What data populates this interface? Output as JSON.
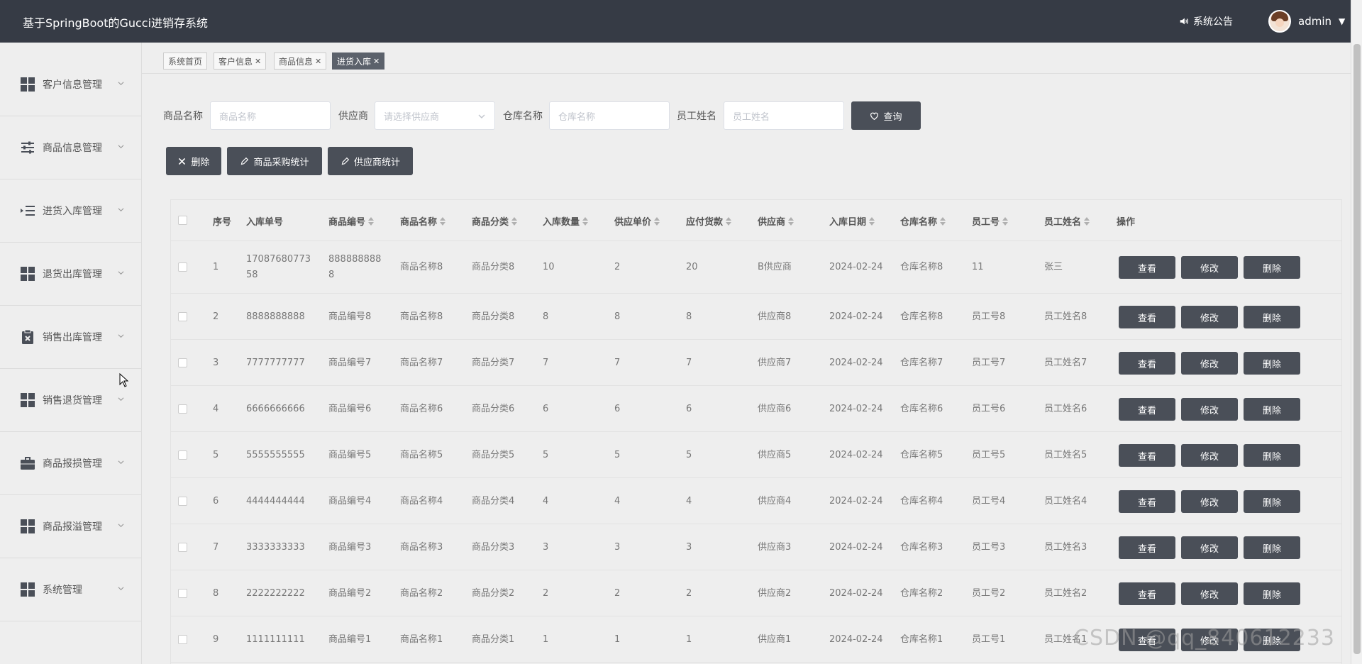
{
  "header": {
    "title": "基于SpringBoot的Gucci进销存系统",
    "notice_label": "系统公告",
    "username": "admin"
  },
  "sidebar": {
    "items": [
      {
        "label": "客户信息管理",
        "icon": "grid-icon"
      },
      {
        "label": "商品信息管理",
        "icon": "sliders-icon"
      },
      {
        "label": "进货入库管理",
        "icon": "indent-list-icon"
      },
      {
        "label": "退货出库管理",
        "icon": "grid-icon"
      },
      {
        "label": "销售出库管理",
        "icon": "clipboard-x-icon"
      },
      {
        "label": "销售退货管理",
        "icon": "grid-icon"
      },
      {
        "label": "商品报损管理",
        "icon": "briefcase-icon"
      },
      {
        "label": "商品报溢管理",
        "icon": "grid-icon"
      },
      {
        "label": "系统管理",
        "icon": "grid-icon"
      }
    ]
  },
  "tabs": [
    {
      "label": "系统首页",
      "closable": false,
      "active": false
    },
    {
      "label": "客户信息",
      "closable": true,
      "active": false
    },
    {
      "label": "商品信息",
      "closable": true,
      "active": false
    },
    {
      "label": "进货入库",
      "closable": true,
      "active": true
    }
  ],
  "search": {
    "product_name_label": "商品名称",
    "product_name_placeholder": "商品名称",
    "supplier_label": "供应商",
    "supplier_placeholder": "请选择供应商",
    "warehouse_label": "仓库名称",
    "warehouse_placeholder": "仓库名称",
    "employee_label": "员工姓名",
    "employee_placeholder": "员工姓名",
    "query_label": "查询"
  },
  "toolbar": {
    "delete_label": "删除",
    "purchase_stats_label": "商品采购统计",
    "supplier_stats_label": "供应商统计"
  },
  "table": {
    "columns": [
      "序号",
      "入库单号",
      "商品编号",
      "商品名称",
      "商品分类",
      "入库数量",
      "供应单价",
      "应付货款",
      "供应商",
      "入库日期",
      "仓库名称",
      "员工号",
      "员工姓名",
      "操作"
    ],
    "rows": [
      {
        "index": "1",
        "order_no": "17087680773 58",
        "product_code": "888888888 8",
        "product_name": "商品名称8",
        "category": "商品分类8",
        "qty": "10",
        "price": "2",
        "payable": "20",
        "supplier": "B供应商",
        "date": "2024-02-24",
        "warehouse": "仓库名称8",
        "emp_no": "11",
        "emp_name": "张三"
      },
      {
        "index": "2",
        "order_no": "8888888888",
        "product_code": "商品编号8",
        "product_name": "商品名称8",
        "category": "商品分类8",
        "qty": "8",
        "price": "8",
        "payable": "8",
        "supplier": "供应商8",
        "date": "2024-02-24",
        "warehouse": "仓库名称8",
        "emp_no": "员工号8",
        "emp_name": "员工姓名8"
      },
      {
        "index": "3",
        "order_no": "7777777777",
        "product_code": "商品编号7",
        "product_name": "商品名称7",
        "category": "商品分类7",
        "qty": "7",
        "price": "7",
        "payable": "7",
        "supplier": "供应商7",
        "date": "2024-02-24",
        "warehouse": "仓库名称7",
        "emp_no": "员工号7",
        "emp_name": "员工姓名7"
      },
      {
        "index": "4",
        "order_no": "6666666666",
        "product_code": "商品编号6",
        "product_name": "商品名称6",
        "category": "商品分类6",
        "qty": "6",
        "price": "6",
        "payable": "6",
        "supplier": "供应商6",
        "date": "2024-02-24",
        "warehouse": "仓库名称6",
        "emp_no": "员工号6",
        "emp_name": "员工姓名6"
      },
      {
        "index": "5",
        "order_no": "5555555555",
        "product_code": "商品编号5",
        "product_name": "商品名称5",
        "category": "商品分类5",
        "qty": "5",
        "price": "5",
        "payable": "5",
        "supplier": "供应商5",
        "date": "2024-02-24",
        "warehouse": "仓库名称5",
        "emp_no": "员工号5",
        "emp_name": "员工姓名5"
      },
      {
        "index": "6",
        "order_no": "4444444444",
        "product_code": "商品编号4",
        "product_name": "商品名称4",
        "category": "商品分类4",
        "qty": "4",
        "price": "4",
        "payable": "4",
        "supplier": "供应商4",
        "date": "2024-02-24",
        "warehouse": "仓库名称4",
        "emp_no": "员工号4",
        "emp_name": "员工姓名4"
      },
      {
        "index": "7",
        "order_no": "3333333333",
        "product_code": "商品编号3",
        "product_name": "商品名称3",
        "category": "商品分类3",
        "qty": "3",
        "price": "3",
        "payable": "3",
        "supplier": "供应商3",
        "date": "2024-02-24",
        "warehouse": "仓库名称3",
        "emp_no": "员工号3",
        "emp_name": "员工姓名3"
      },
      {
        "index": "8",
        "order_no": "2222222222",
        "product_code": "商品编号2",
        "product_name": "商品名称2",
        "category": "商品分类2",
        "qty": "2",
        "price": "2",
        "payable": "2",
        "supplier": "供应商2",
        "date": "2024-02-24",
        "warehouse": "仓库名称2",
        "emp_no": "员工号2",
        "emp_name": "员工姓名2"
      },
      {
        "index": "9",
        "order_no": "1111111111",
        "product_code": "商品编号1",
        "product_name": "商品名称1",
        "category": "商品分类1",
        "qty": "1",
        "price": "1",
        "payable": "1",
        "supplier": "供应商1",
        "date": "2024-02-24",
        "warehouse": "仓库名称1",
        "emp_no": "员工号1",
        "emp_name": "员工姓名1"
      }
    ],
    "row_actions": {
      "view": "查看",
      "edit": "修改",
      "delete": "删除"
    }
  },
  "watermark": "CSDN @qq_840612233",
  "colors": {
    "header_bg": "#363b45",
    "button_bg": "#4a4f58",
    "active_tab_bg": "#5b616b",
    "page_bg": "#eeeeee"
  }
}
